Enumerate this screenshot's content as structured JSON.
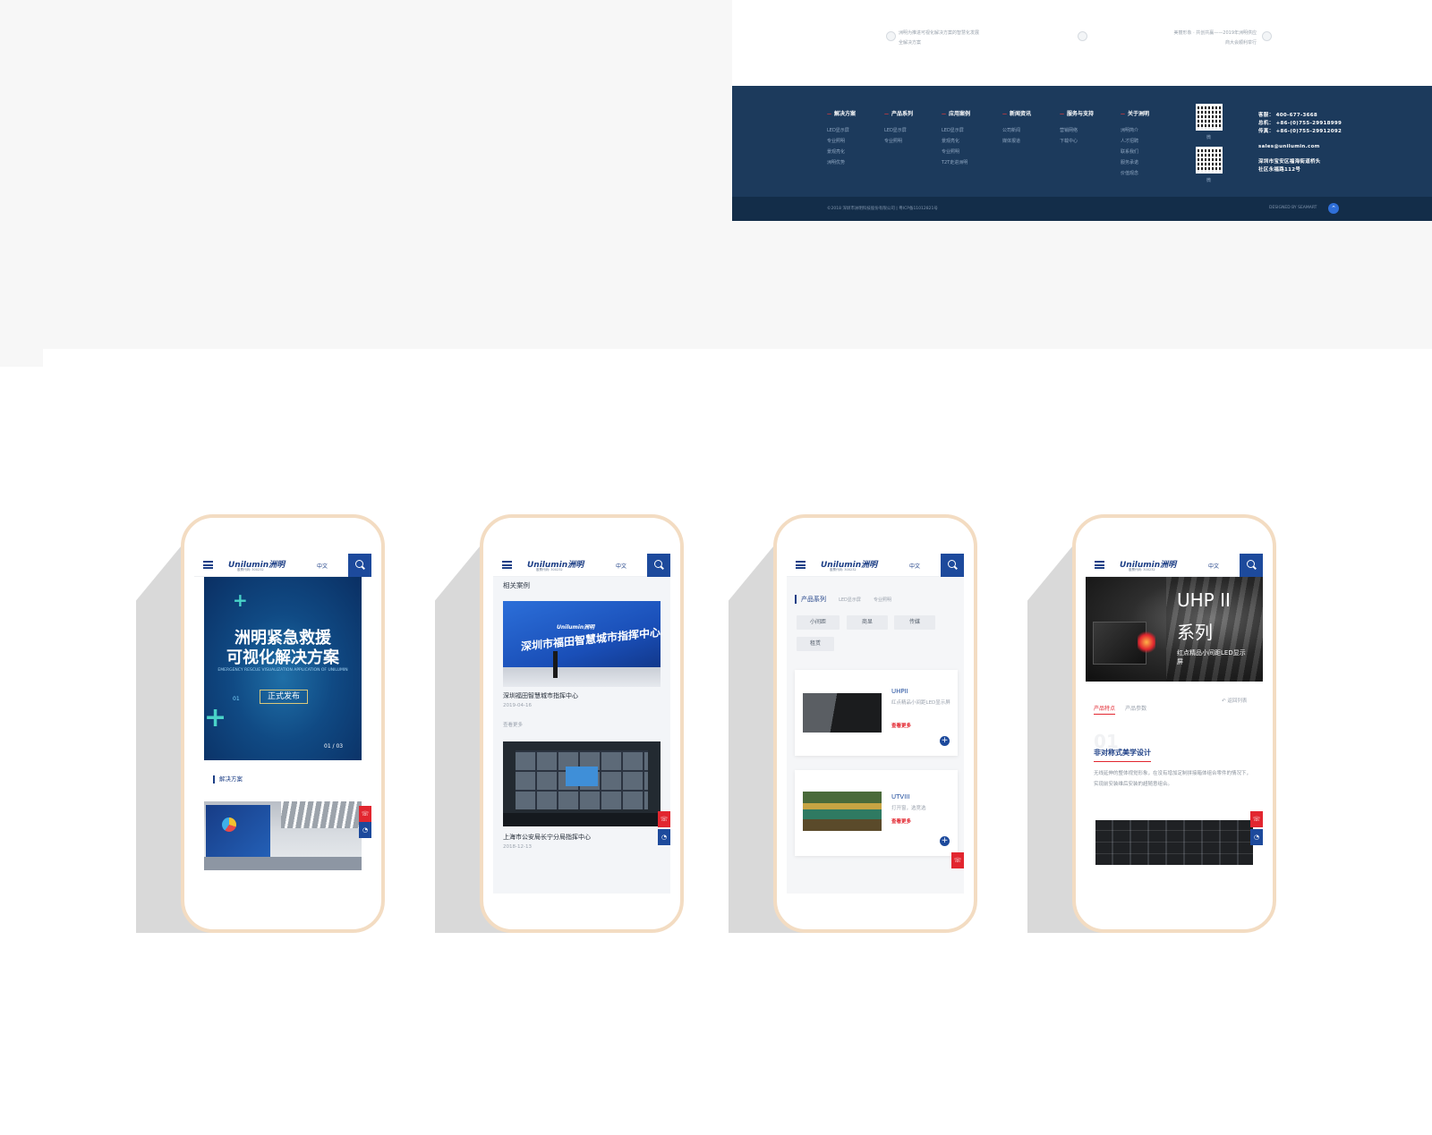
{
  "footer_mock": {
    "features": [
      {
        "line1": "洲明为推进可视化解决方案的智慧化发展",
        "line2": "全解决方案"
      },
      {
        "line1": "",
        "line2": ""
      },
      {
        "line1": "美丽形象 · 共创共赢——2019年洲明供应",
        "line2": "商大会顺利举行"
      }
    ],
    "columns": [
      {
        "title": "解决方案",
        "items": [
          "LED显示屏",
          "专业照明",
          "景观亮化",
          "洲明优势"
        ]
      },
      {
        "title": "产品系列",
        "items": [
          "LED显示屏",
          "专业照明"
        ]
      },
      {
        "title": "应用案例",
        "items": [
          "LED显示屏",
          "景观亮化",
          "专业照明",
          "T2T走进洲明"
        ]
      },
      {
        "title": "新闻资讯",
        "items": [
          "公司新闻",
          "媒体报道"
        ]
      },
      {
        "title": "服务与支持",
        "items": [
          "营销网络",
          "下载中心"
        ]
      },
      {
        "title": "关于洲明",
        "items": [
          "洲明简介",
          "人才招聘",
          "联系我们",
          "服务承诺",
          "价值观念"
        ]
      }
    ],
    "qr_captions": [
      "微",
      "微"
    ],
    "contact": {
      "hotline": "客服： 400-677-3668",
      "phone": "总机： +86-(0)755-29918999",
      "fax": "传真： +86-(0)755-29912092",
      "email": "sales@unilumin.com",
      "address1": "深圳市宝安区福海街道桥头",
      "address2": "社区永福路112号"
    },
    "copyright": "©2018 深圳市洲明科技股份有限公司 | 粤ICP备11012821号",
    "design_by": "DESIGNED BY SEAMART",
    "to_top_icon": "arrow-up-icon"
  },
  "common": {
    "logo": "Unilumin洲明",
    "logo_sub": "股票代码: 300232",
    "lang": "中文",
    "float_icons": [
      "phone-icon",
      "chat-icon"
    ]
  },
  "phone1": {
    "hero_title_1": "洲明紧急救援",
    "hero_title_2": "可视化解决方案",
    "hero_en": "EMERGENCY RESCUE VISUALIZATION APPLICATION OF UNILUMIN",
    "hero_tag": "正式发布",
    "hero_index": "01",
    "pager": "01 / 03",
    "section_label": "解决方案"
  },
  "phone2": {
    "section_title": "相关案例",
    "cases": [
      {
        "image_text": "深圳市福田智慧城市指挥中心",
        "name": "深圳福田智慧城市指挥中心",
        "date": "2019-04-16",
        "more": "查看更多"
      },
      {
        "name": "上海市公安局长宁分局指挥中心",
        "date": "2018-12-13"
      }
    ]
  },
  "phone3": {
    "tab_active": "产品系列",
    "tabs": [
      "LED显示屏",
      "专业照明"
    ],
    "chips": [
      "小间距",
      "商显",
      "传媒",
      "租赁"
    ],
    "products": [
      {
        "name": "UHPII",
        "desc": "红点精品小间距LED显示屏",
        "more": "查看更多"
      },
      {
        "name": "UTVIII",
        "desc": "打开窗，选竞选",
        "more": "查看更多"
      }
    ]
  },
  "phone4": {
    "hero_line1": "UHP II",
    "hero_line2": "系列",
    "hero_desc": "红点精品小间距LED显示屏",
    "tab_active": "产品特点",
    "tab_other": "产品参数",
    "back": "返回列表",
    "feature_no": "01",
    "feature_title": "非对称式美学设计",
    "feature_desc": "无线延伸的整体视觉形象，在没有增加定制拼接箱体组合零件的情况下，实现前安装维后安装的超随意组合。"
  }
}
